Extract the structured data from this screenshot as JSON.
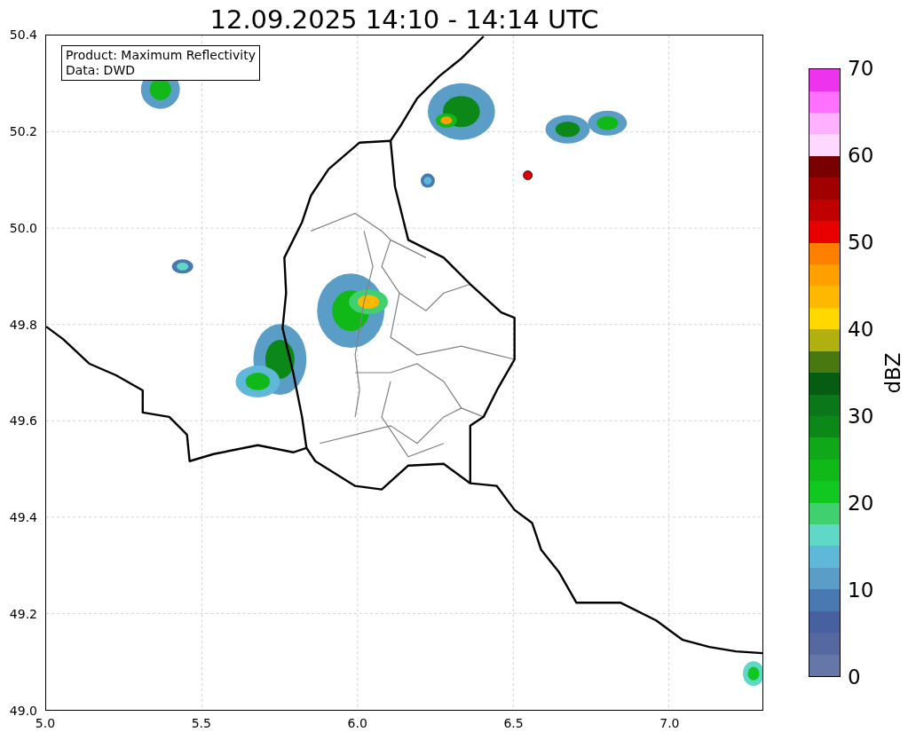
{
  "title": "12.09.2025 14:10 - 14:14 UTC",
  "info_box": [
    "Product: Maximum Reflectivity",
    "Data: DWD"
  ],
  "x_ticks": [
    "5.0",
    "5.5",
    "6.0",
    "6.5",
    "7.0"
  ],
  "y_ticks": [
    "50.4",
    "50.2",
    "50.0",
    "49.8",
    "49.6",
    "49.4",
    "49.2",
    "49.0"
  ],
  "colorbar": {
    "label": "dBZ",
    "ticks": [
      "70",
      "60",
      "50",
      "40",
      "30",
      "20",
      "10",
      "0"
    ],
    "bands": [
      {
        "color": "#6577a8"
      },
      {
        "color": "#5568a0"
      },
      {
        "color": "#4660a0"
      },
      {
        "color": "#4a78b0"
      },
      {
        "color": "#5a9ec8"
      },
      {
        "color": "#60b8d8"
      },
      {
        "color": "#60d8c8"
      },
      {
        "color": "#40d070"
      },
      {
        "color": "#10c820"
      },
      {
        "color": "#10b818"
      },
      {
        "color": "#0ea818"
      },
      {
        "color": "#0c8818"
      },
      {
        "color": "#0a7818"
      },
      {
        "color": "#065c10"
      },
      {
        "color": "#4a7810"
      },
      {
        "color": "#b0b010"
      },
      {
        "color": "#ffd800"
      },
      {
        "color": "#ffb800"
      },
      {
        "color": "#ffa000"
      },
      {
        "color": "#ff8000"
      },
      {
        "color": "#e80000"
      },
      {
        "color": "#c00000"
      },
      {
        "color": "#a00000"
      },
      {
        "color": "#780000"
      },
      {
        "color": "#ffd8ff"
      },
      {
        "color": "#ffb0ff"
      },
      {
        "color": "#ff70ff"
      },
      {
        "color": "#ee33ee"
      }
    ]
  }
}
